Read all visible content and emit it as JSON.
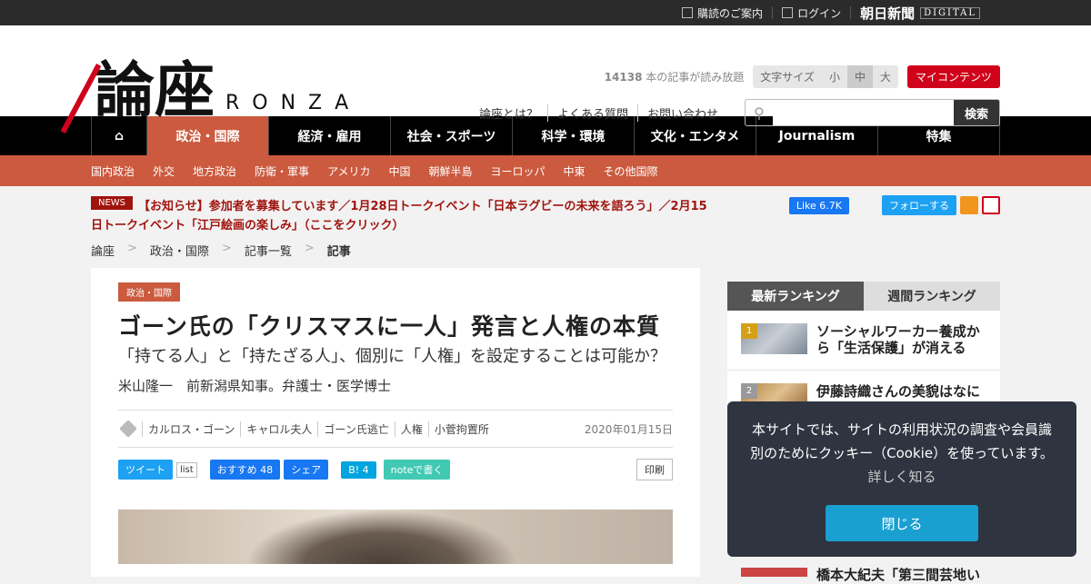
{
  "topbar": {
    "subscribe": "購読のご案内",
    "login": "ログイン",
    "brand": "朝日新聞",
    "brand_sub": "DIGITAL"
  },
  "header": {
    "logo_kanji": "論座",
    "logo_roman": "RONZA",
    "count_num": "14138",
    "count_text": "本の記事が読み放題",
    "font_size_label": "文字サイズ",
    "font_small": "小",
    "font_medium": "中",
    "font_large": "大",
    "my_contents": "マイコンテンツ",
    "links": [
      "論座とは？",
      "よくある質問",
      "お問い合わせ"
    ],
    "search_button": "検索",
    "search_placeholder": ""
  },
  "nav": {
    "items": [
      "政治・国際",
      "経済・雇用",
      "社会・スポーツ",
      "科学・環境",
      "文化・エンタメ",
      "Journalism",
      "特集"
    ]
  },
  "subnav": {
    "items": [
      "国内政治",
      "外交",
      "地方政治",
      "防衛・軍事",
      "アメリカ",
      "中国",
      "朝鮮半島",
      "ヨーロッパ",
      "中東",
      "その他国際"
    ]
  },
  "news": {
    "badge": "NEWS",
    "text": "【お知らせ】参加者を募集しています／1月28日トークイベント「日本ラグビーの未来を語ろう」／2月15日トークイベント「江戸絵画の楽しみ」（ここをクリック）"
  },
  "social": {
    "fb_like": "Like 6.7K",
    "tw_follow": "フォローする"
  },
  "breadcrumb": [
    "論座",
    "政治・国際",
    "記事一覧",
    "記事"
  ],
  "breadcrumb_sep": ">",
  "article": {
    "category": "政治・国際",
    "title": "ゴーン氏の「クリスマスに一人」発言と人権の本質",
    "subtitle": "「持てる人」と「持たざる人」、個別に「人権」を設定することは可能か？",
    "author": "米山隆一　前新潟県知事。弁護士・医学博士",
    "tags": [
      "カルロス・ゴーン",
      "キャロル夫人",
      "ゴーン氏逃亡",
      "人権",
      "小菅拘置所"
    ],
    "date": "2020年01月15日",
    "share": {
      "tweet": "ツイート",
      "list": "list",
      "fb_recommend": "おすすめ 48",
      "fb_share": "シェア",
      "hatena": "B! 4",
      "note": "noteで書く",
      "print": "印刷"
    }
  },
  "ranking": {
    "tab_latest": "最新ランキング",
    "tab_weekly": "週間ランキング",
    "items": [
      {
        "rank": "1",
        "title": "ソーシャルワーカー養成から「生活保護」が消える",
        "color": "#d4a017"
      },
      {
        "rank": "2",
        "title": "伊藤詩織さんの美貌はなに",
        "color": "#999999"
      }
    ],
    "item3_title": "橋本大紀夫「第三間芸地い"
  },
  "cookie": {
    "message": "本サイトでは、サイトの利用状況の調査や会員識別のためにクッキー（Cookie）を使っています。",
    "more": "詳しく知る",
    "close": "閉じる"
  }
}
